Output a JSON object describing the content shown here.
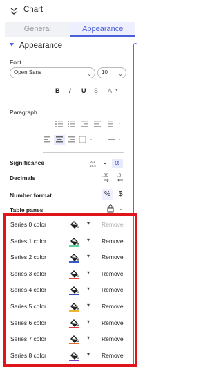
{
  "header": {
    "title": "Chart"
  },
  "tabs": [
    {
      "label": "General",
      "active": false
    },
    {
      "label": "Appearance",
      "active": true
    }
  ],
  "section": {
    "title": "Appearance"
  },
  "font": {
    "label": "Font",
    "family_value": "Open Sans",
    "size_value": "10",
    "style_buttons": [
      "B",
      "I",
      "U",
      "S",
      "A"
    ]
  },
  "paragraph": {
    "label": "Paragraph"
  },
  "significance": {
    "label": "Significance",
    "alpha": "α"
  },
  "decimals": {
    "label": "Decimals",
    "increase": ".00",
    "decrease": ".0"
  },
  "number_format": {
    "label": "Number format",
    "percent": "%",
    "currency": "$"
  },
  "table_panes": {
    "label": "Table panes"
  },
  "series": [
    {
      "name": "Series 0 color",
      "color": "#ffffff",
      "remove": "Remove",
      "remove_enabled": false
    },
    {
      "name": "Series 1 color",
      "color": "#5fd3a0",
      "remove": "Remove",
      "remove_enabled": true
    },
    {
      "name": "Series 2 color",
      "color": "#3a57c7",
      "remove": "Remove",
      "remove_enabled": true
    },
    {
      "name": "Series 3 color",
      "color": "#e8463f",
      "remove": "Remove",
      "remove_enabled": true
    },
    {
      "name": "Series 4 color",
      "color": "#2f4fb0",
      "remove": "Remove",
      "remove_enabled": true
    },
    {
      "name": "Series 5 color",
      "color": "#f0b430",
      "remove": "Remove",
      "remove_enabled": true
    },
    {
      "name": "Series 6 color",
      "color": "#d9363e",
      "remove": "Remove",
      "remove_enabled": true
    },
    {
      "name": "Series 7 color",
      "color": "#e06a2a",
      "remove": "Remove",
      "remove_enabled": true
    },
    {
      "name": "Series 8 color",
      "color": "#7a3fc7",
      "remove": "Remove",
      "remove_enabled": true
    }
  ],
  "colors": {
    "accent": "#4a5fd8",
    "highlight_border": "#e0151b"
  }
}
